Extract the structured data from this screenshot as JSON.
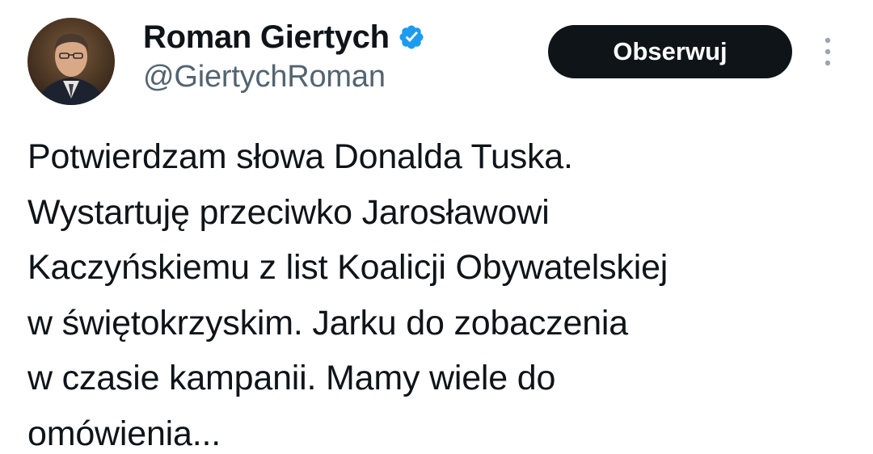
{
  "author": {
    "display_name": "Roman Giertych",
    "handle": "@GiertychRoman",
    "verified": true,
    "verified_color": "#1d9bf0"
  },
  "actions": {
    "follow_label": "Obserwuj",
    "more_icon": "more-vertical-icon"
  },
  "tweet": {
    "lines": [
      "Potwierdzam słowa Donalda Tuska.",
      "Wystartuję przeciwko Jarosławowi",
      "Kaczyńskiemu z list Koalicji Obywatelskiej",
      "w świętokrzyskim. Jarku do zobaczenia",
      "w czasie kampanii. Mamy wiele do",
      "omówienia..."
    ]
  },
  "colors": {
    "text": "#0f1419",
    "secondary": "#536471",
    "button_bg": "#0f1419",
    "button_text": "#ffffff"
  }
}
